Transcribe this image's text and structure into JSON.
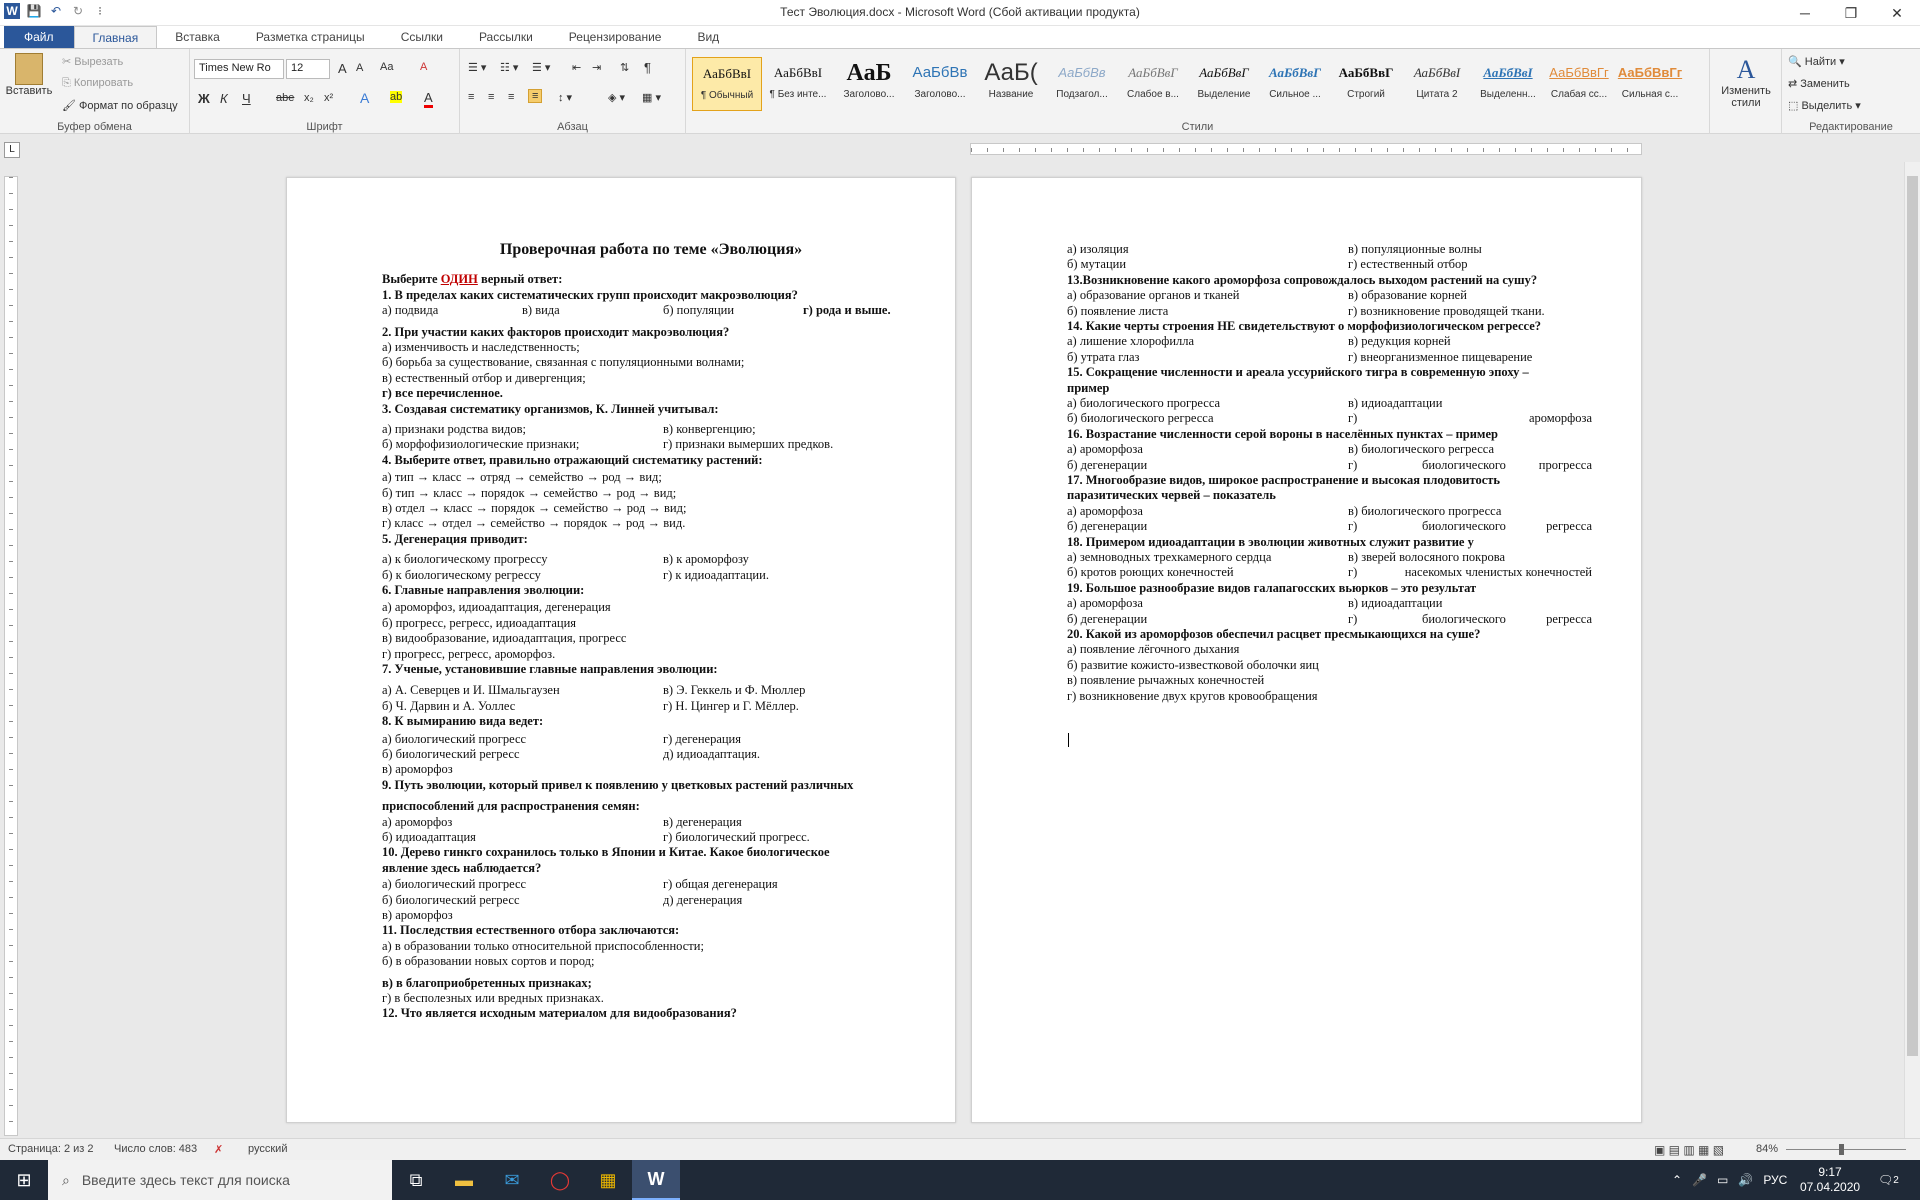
{
  "window": {
    "title": "Тест Эволюция.docx  -  Microsoft Word (Сбой активации продукта)",
    "min": "─",
    "max": "❐",
    "close": "✕"
  },
  "qat": {
    "word": "W",
    "save": "💾",
    "undo": "↶",
    "redo": "↻",
    "more": "⁝"
  },
  "tabs": [
    "Главная",
    "Вставка",
    "Разметка страницы",
    "Ссылки",
    "Рассылки",
    "Рецензирование",
    "Вид"
  ],
  "file_tab": "Файл",
  "clipboard": {
    "paste": "Вставить",
    "cut": "Вырезать",
    "copy": "Копировать",
    "format_painter": "Формат по образцу",
    "label": "Буфер обмена"
  },
  "font": {
    "name": "Times New Ro",
    "size": "12",
    "label": "Шрифт",
    "bold": "Ж",
    "italic": "К",
    "underline": "Ч",
    "strike": "abe",
    "sub": "x₂",
    "sup": "x²",
    "grow": "A",
    "shrink": "A",
    "case": "Aa",
    "clear": "A",
    "effects": "A",
    "highlight": "ab",
    "color": "A"
  },
  "paragraph": {
    "label": "Абзац"
  },
  "styles": {
    "label": "Стили",
    "change": "Изменить стили",
    "items": [
      {
        "preview": "АаБбВвІ",
        "name": "¶ Обычный"
      },
      {
        "preview": "АаБбВвІ",
        "name": "¶ Без инте..."
      },
      {
        "preview": "АаБ",
        "name": "Заголово..."
      },
      {
        "preview": "АаБбВв",
        "name": "Заголово..."
      },
      {
        "preview": "АаБ(",
        "name": "Название"
      },
      {
        "preview": "АаБбВв",
        "name": "Подзагол..."
      },
      {
        "preview": "АаБбВвГ",
        "name": "Слабое в..."
      },
      {
        "preview": "АаБбВвГ",
        "name": "Выделение"
      },
      {
        "preview": "АаБбВвГ",
        "name": "Сильное ..."
      },
      {
        "preview": "АаБбВвГ",
        "name": "Строгий"
      },
      {
        "preview": "АаБбВвІ",
        "name": "Цитата 2"
      },
      {
        "preview": "АаБбВвІ",
        "name": "Выделенн..."
      },
      {
        "preview": "АаБбВвГг",
        "name": "Слабая сс..."
      },
      {
        "preview": "АаБбВвГг",
        "name": "Сильная с..."
      }
    ]
  },
  "editing": {
    "find": "Найти",
    "replace": "Заменить",
    "select": "Выделить",
    "label": "Редактирование"
  },
  "page1": [
    {
      "t": "Проверочная работа по теме «Эволюция»",
      "c": "h1"
    },
    {
      "t": "Выберите ",
      "t2": "ОДИН",
      "t3": " верный ответ:",
      "c": "q"
    },
    {
      "t": "1. В пределах каких систематических групп происходит макроэволюция?",
      "c": "q"
    },
    {
      "cols": [
        "а) подвида",
        "в) вида",
        "б) популяции",
        "г) рода и выше."
      ]
    },
    {
      "t": "2. При участии каких факторов происходит макроэволюция?",
      "c": "q"
    },
    {
      "t": "а) изменчивость и наследственность;"
    },
    {
      "t": "б) борьба за существование, связанная с популяционными волнами;"
    },
    {
      "t": "в) естественный отбор и дивергенция;"
    },
    {
      "t": "г) все перечисленное.",
      "c": "q"
    },
    {
      "t": "3. Создавая систематику организмов, К. Линней учитывал:",
      "c": "q"
    },
    {
      "cols": [
        "а) признаки родства видов;",
        "в) конвергенцию;"
      ]
    },
    {
      "cols": [
        "б) морфофизиологические признаки;",
        "г) признаки вымерших предков."
      ]
    },
    {
      "t": "4. Выберите ответ, правильно отражающий систематику растений:",
      "c": "q"
    },
    {
      "t": "а) тип → класс → отряд → семейство → род → вид;"
    },
    {
      "t": "б) тип → класс → порядок → семейство → род → вид;"
    },
    {
      "t": "в) отдел → класс → порядок → семейство → род → вид;"
    },
    {
      "t": "г) класс → отдел → семейство → порядок → род → вид."
    },
    {
      "t": "5. Дегенерация приводит:",
      "c": "q"
    },
    {
      "cols": [
        "а) к биологическому прогрессу",
        "в) к ароморфозу"
      ]
    },
    {
      "cols": [
        "б) к биологическому регрессу",
        "г) к идиоадаптации."
      ]
    },
    {
      "t": "6. Главные направления эволюции:",
      "c": "q"
    },
    {
      "t": "а) ароморфоз, идиоадаптация, дегенерация"
    },
    {
      "t": "б) прогресс, регресс, идиоадаптация"
    },
    {
      "t": "в) видообразование, идиоадаптация, прогресс"
    },
    {
      "t": "г) прогресс, регресс, ароморфоз."
    },
    {
      "t": "7. Ученые, установившие главные направления эволюции:",
      "c": "q"
    },
    {
      "cols": [
        "а) А. Северцев и И. Шмальгаузен",
        "в) Э. Геккель и Ф. Мюллер"
      ]
    },
    {
      "cols": [
        "б) Ч. Дарвин и А. Уоллес",
        "г) Н. Цингер и Г. Мёллер."
      ]
    },
    {
      "t": "8. К вымиранию вида ведет:",
      "c": "q"
    },
    {
      "cols": [
        "а) биологический прогресс",
        "г) дегенерация"
      ]
    },
    {
      "cols": [
        "б) биологический регресс",
        "д) идиоадаптация."
      ]
    },
    {
      "t": "в) ароморфоз"
    },
    {
      "t": "9. Путь эволюции, который привел к появлению у цветковых растений различных",
      "c": "q"
    },
    {
      "t": "приспособлений для распространения семян:",
      "c": "q"
    },
    {
      "cols": [
        "а) ароморфоз",
        "в) дегенерация"
      ]
    },
    {
      "cols": [
        "б) идиоадаптация",
        "г) биологический прогресс."
      ]
    },
    {
      "t": "10. Дерево гинкго сохранилось только в Японии и Китае. Какое биологическое",
      "c": "q"
    },
    {
      "t": "явление здесь наблюдается?",
      "c": "q"
    },
    {
      "cols": [
        "а) биологический прогресс",
        "г) общая дегенерация"
      ]
    },
    {
      "cols": [
        "б) биологический регресс",
        "д) дегенерация"
      ]
    },
    {
      "t": "в) ароморфоз"
    },
    {
      "t": "11. Последствия естественного отбора заключаются:",
      "c": "q"
    },
    {
      "t": "а) в образовании только относительной приспособленности;"
    },
    {
      "t": "б) в образовании новых сортов и пород;"
    },
    {
      "t": "в) в благоприобретенных признаках;",
      "c": "q"
    },
    {
      "t": "г) в бесполезных или вредных признаках."
    },
    {
      "t": "12. Что является исходным материалом для видообразования?",
      "c": "q"
    }
  ],
  "page2": [
    {
      "cols": [
        "а) изоляция",
        "в) популяционные волны"
      ]
    },
    {
      "cols": [
        "б) мутации",
        "г) естественный отбор"
      ]
    },
    {
      "t": "13.Возникновение какого ароморфоза сопровождалось выходом растений на сушу?",
      "c": "q"
    },
    {
      "cols": [
        "а) образование органов и тканей",
        "в) образование корней"
      ]
    },
    {
      "cols": [
        "б) появление листа",
        "г) возникновение проводящей ткани."
      ]
    },
    {
      "t": "14. Какие черты строения НЕ свидетельствуют о морфофизиологическом регрессе?",
      "c": "q"
    },
    {
      "cols": [
        "а) лишение хлорофилла",
        "в) редукция корней"
      ]
    },
    {
      "cols": [
        "б) утрата глаз",
        "г) внеорганизменное пищеварение"
      ]
    },
    {
      "t": "15. Сокращение численности и ареала уссурийского тигра в современную эпоху –",
      "c": "q"
    },
    {
      "t": "пример",
      "c": "q"
    },
    {
      "cols": [
        "а) биологического прогресса",
        "в) идиоадаптации"
      ]
    },
    {
      "cols": [
        "б) биологического регресса",
        "г)",
        "ароморфоза"
      ]
    },
    {
      "t": "16. Возрастание численности серой вороны в населённых пунктах – пример",
      "c": "q"
    },
    {
      "cols": [
        "а) ароморфоза",
        "в) биологического регресса"
      ]
    },
    {
      "cols": [
        "б) дегенерации",
        "г)",
        "биологического",
        "прогресса"
      ]
    },
    {
      "t": "17. Многообразие видов, широкое распространение и высокая плодовитость",
      "c": "q"
    },
    {
      "t": "паразитических червей – показатель",
      "c": "q"
    },
    {
      "cols": [
        "а) ароморфоза",
        "в) биологического прогресса"
      ]
    },
    {
      "cols": [
        "б) дегенерации",
        "г)",
        "биологического",
        "регресса"
      ]
    },
    {
      "t": "18. Примером идиоадаптации в эволюции животных служит развитие у",
      "c": "q"
    },
    {
      "cols": [
        "а) земноводных трехкамерного сердца",
        "в) зверей волосяного покрова"
      ]
    },
    {
      "cols": [
        "б) кротов роющих конечностей",
        "г)",
        "насекомых членистых конечностей"
      ]
    },
    {
      "t": "19. Большое разнообразие видов галапагосских вьюрков – это результат",
      "c": "q"
    },
    {
      "cols": [
        "а) ароморфоза",
        "в) идиоадаптации"
      ]
    },
    {
      "cols": [
        "б) дегенерации",
        "г)",
        "биологического",
        "регресса"
      ]
    },
    {
      "t": "20. Какой из ароморфозов обеспечил расцвет пресмыкающихся на суше?",
      "c": "q"
    },
    {
      "t": "а) появление лёгочного дыхания"
    },
    {
      "t": "б) развитие кожисто-известковой оболочки яиц"
    },
    {
      "t": "в) появление рычажных конечностей"
    },
    {
      "t": "г) возникновение двух кругов кровообращения"
    }
  ],
  "status": {
    "page": "Страница: 2 из 2",
    "words": "Число слов: 483",
    "lang": "русский",
    "zoom": "84%"
  },
  "taskbar": {
    "search": "Введите здесь текст для поиска",
    "lang": "РУС",
    "time": "9:17",
    "date": "07.04.2020",
    "notif": "2"
  }
}
